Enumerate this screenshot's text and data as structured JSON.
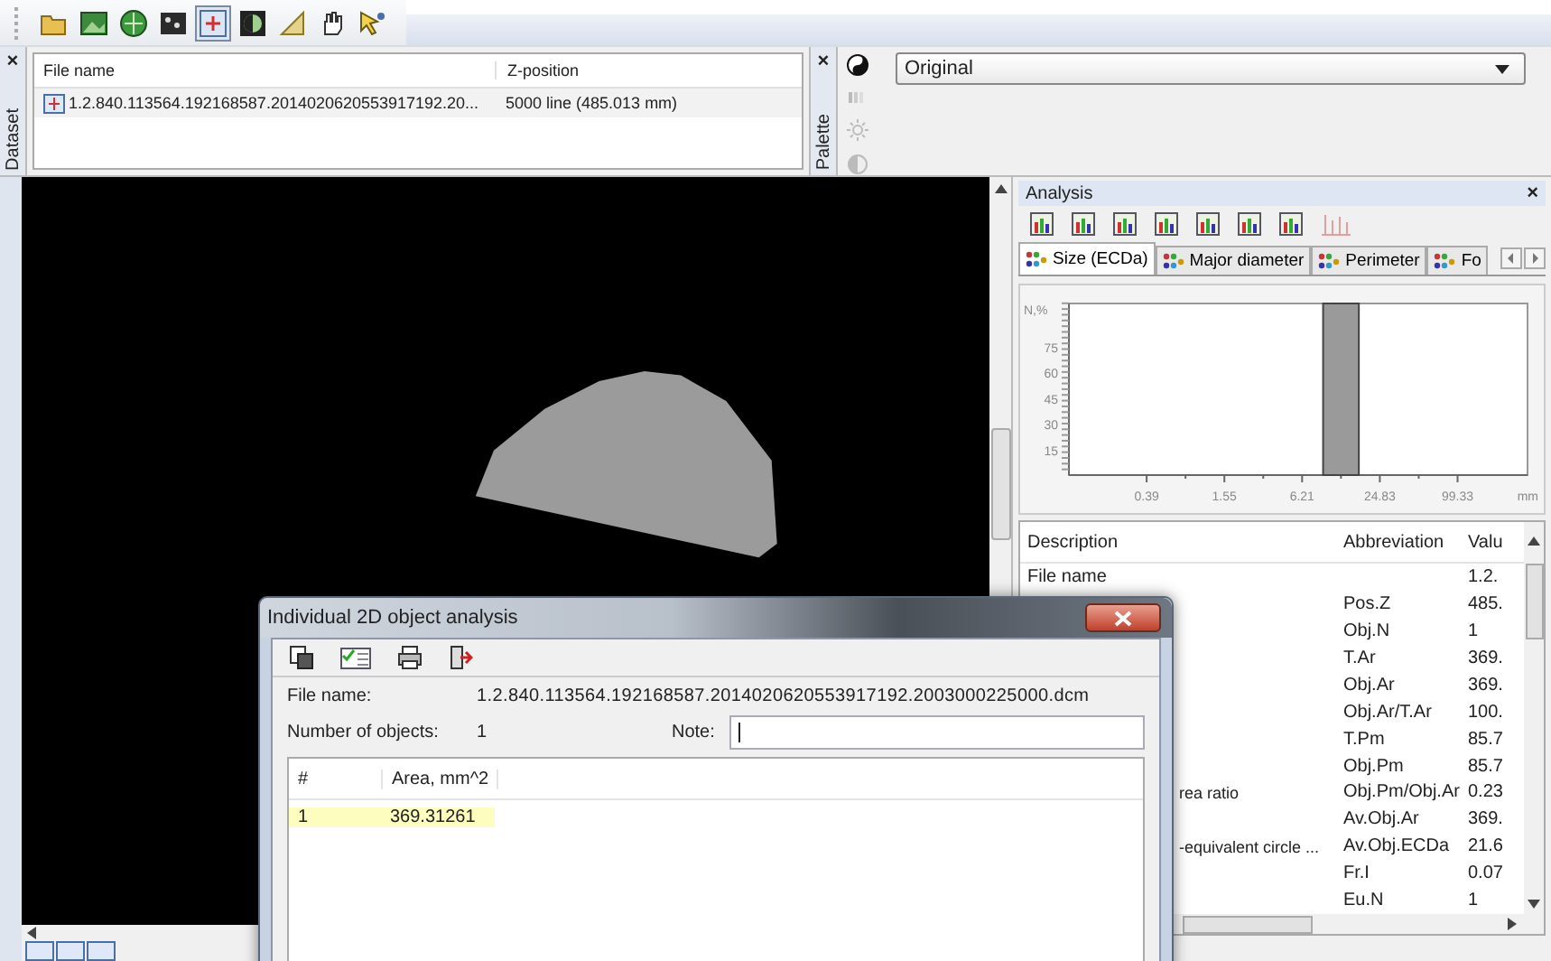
{
  "toolbar": [
    {
      "kind": "folder",
      "selected": false
    },
    {
      "kind": "image",
      "selected": false
    },
    {
      "kind": "globe",
      "selected": false
    },
    {
      "kind": "dots",
      "selected": false
    },
    {
      "kind": "target",
      "selected": true
    },
    {
      "kind": "contrast",
      "selected": false
    },
    {
      "kind": "ruler",
      "selected": false
    },
    {
      "kind": "hand",
      "selected": false
    },
    {
      "kind": "help",
      "selected": false
    }
  ],
  "dataset": {
    "tab": "Dataset",
    "close": "×",
    "columns": [
      "File name",
      "Z-position"
    ],
    "rows": [
      {
        "file": "1.2.840.113564.192168587.2014020620553917192.20...",
        "z": "5000 line (485.013 mm)"
      }
    ]
  },
  "palette": {
    "tab": "Palette",
    "close": "×",
    "dropdown": "Original"
  },
  "analysis": {
    "title": "Analysis",
    "close": "×",
    "tabs": [
      {
        "label": "Size (ECDa)",
        "selected": true
      },
      {
        "label": "Major diameter",
        "selected": false
      },
      {
        "label": "Perimeter",
        "selected": false
      },
      {
        "label": "Fo",
        "selected": false
      }
    ],
    "chart_data": {
      "type": "bar",
      "ylabel": "N,%",
      "xlabel": "mm",
      "ylim": [
        0,
        100
      ],
      "yticks": [
        15,
        30,
        45,
        60,
        75
      ],
      "categories": [
        "0.39",
        null,
        "1.55",
        null,
        "6.21",
        null,
        "24.83",
        null,
        "99.33"
      ],
      "series": [
        {
          "color": "#9a9a9a",
          "values": [
            null,
            null,
            null,
            null,
            null,
            100,
            null,
            null,
            null
          ]
        }
      ]
    },
    "table": {
      "columns": [
        "Description",
        "Abbreviation",
        "Valu"
      ],
      "rows": [
        {
          "description": "File name",
          "value": "1.2."
        },
        {
          "abbreviation": "Pos.Z",
          "value": "485."
        },
        {
          "abbreviation": "Obj.N",
          "value": "1"
        },
        {
          "abbreviation": "T.Ar",
          "value": "369."
        },
        {
          "abbreviation": "Obj.Ar",
          "value": "369."
        },
        {
          "abbreviation": "Obj.Ar/T.Ar",
          "value": "100."
        },
        {
          "abbreviation": "T.Pm",
          "value": "85.7"
        },
        {
          "abbreviation": "Obj.Pm",
          "value": "85.7"
        },
        {
          "description": "rea ratio",
          "cut_left": true,
          "abbreviation": "Obj.Pm/Obj.Ar",
          "value": "0.23"
        },
        {
          "abbreviation": "Av.Obj.Ar",
          "value": "369."
        },
        {
          "description": "-equivalent circle ...",
          "cut_left": true,
          "abbreviation": "Av.Obj.ECDa",
          "value": "21.6"
        },
        {
          "abbreviation": "Fr.I",
          "value": "0.07"
        },
        {
          "abbreviation": "Eu.N",
          "value": "1"
        }
      ]
    }
  },
  "dialog": {
    "title": "Individual 2D object analysis",
    "file_label": "File name:",
    "file_name": "1.2.840.113564.192168587.2014020620553917192.2003000225000.dcm",
    "count_label": "Number of objects:",
    "count": "1",
    "note_label": "Note:",
    "table": {
      "columns": [
        "#",
        "Area, mm^2"
      ],
      "rows": [
        {
          "cells": [
            "1",
            "369.31261"
          ],
          "selected": true
        }
      ]
    }
  }
}
